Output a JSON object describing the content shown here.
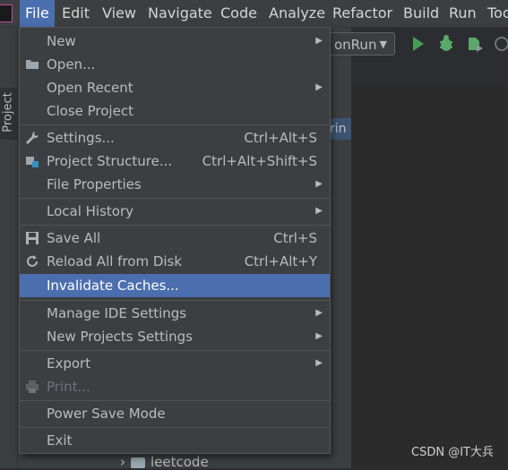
{
  "menubar": {
    "items": [
      {
        "label": "File",
        "active": true
      },
      {
        "label": "Edit"
      },
      {
        "label": "View"
      },
      {
        "label": "Navigate"
      },
      {
        "label": "Code"
      },
      {
        "label": "Analyze"
      },
      {
        "label": "Refactor"
      },
      {
        "label": "Build"
      },
      {
        "label": "Run"
      },
      {
        "label": "Too"
      }
    ]
  },
  "toolbar": {
    "run_config": "onRun"
  },
  "sidebar": {
    "project_tab": "Project"
  },
  "editor": {
    "tab_fragment": "rin"
  },
  "tree": {
    "visible_row": "leetcode"
  },
  "file_menu": {
    "items": [
      {
        "label": "New",
        "shortcut": "",
        "submenu": true
      },
      {
        "label": "Open...",
        "shortcut": "",
        "icon": "folder-open-icon"
      },
      {
        "label": "Open Recent",
        "shortcut": "",
        "submenu": true
      },
      {
        "label": "Close Project",
        "shortcut": ""
      },
      {
        "label": "Settings...",
        "shortcut": "Ctrl+Alt+S",
        "icon": "wrench-icon"
      },
      {
        "label": "Project Structure...",
        "shortcut": "Ctrl+Alt+Shift+S",
        "icon": "project-structure-icon"
      },
      {
        "label": "File Properties",
        "shortcut": "",
        "submenu": true
      },
      {
        "label": "Local History",
        "shortcut": "",
        "submenu": true
      },
      {
        "label": "Save All",
        "shortcut": "Ctrl+S",
        "icon": "save-icon"
      },
      {
        "label": "Reload All from Disk",
        "shortcut": "Ctrl+Alt+Y",
        "icon": "reload-icon"
      },
      {
        "label": "Invalidate Caches...",
        "shortcut": "",
        "highlighted": true
      },
      {
        "label": "Manage IDE Settings",
        "shortcut": "",
        "submenu": true
      },
      {
        "label": "New Projects Settings",
        "shortcut": "",
        "submenu": true
      },
      {
        "label": "Export",
        "shortcut": "",
        "submenu": true
      },
      {
        "label": "Print...",
        "shortcut": "",
        "disabled": true,
        "icon": "printer-icon"
      },
      {
        "label": "Power Save Mode",
        "shortcut": ""
      },
      {
        "label": "Exit",
        "shortcut": ""
      }
    ]
  },
  "watermark": "CSDN @IT大兵",
  "colors": {
    "menu_bg": "#3c3f41",
    "highlight": "#4b6eaf",
    "run_green": "#499c54",
    "debug_green": "#59a869"
  }
}
